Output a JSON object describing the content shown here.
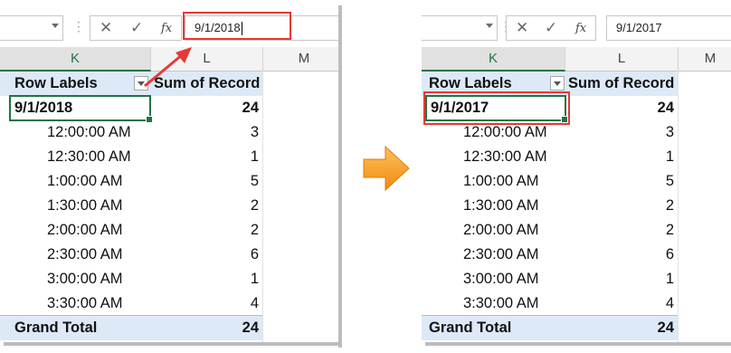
{
  "left": {
    "formula": {
      "value": "9/1/2018",
      "fx_label": "fx"
    },
    "columns": [
      "K",
      "L",
      "M"
    ],
    "header": {
      "row_labels": "Row Labels",
      "sum_label": "Sum of Record"
    },
    "date_row": {
      "label": "9/1/2018",
      "value": "24"
    },
    "rows": [
      {
        "label": "12:00:00 AM",
        "value": "3"
      },
      {
        "label": "12:30:00 AM",
        "value": "1"
      },
      {
        "label": "1:00:00 AM",
        "value": "5"
      },
      {
        "label": "1:30:00 AM",
        "value": "2"
      },
      {
        "label": "2:00:00 AM",
        "value": "2"
      },
      {
        "label": "2:30:00 AM",
        "value": "6"
      },
      {
        "label": "3:00:00 AM",
        "value": "1"
      },
      {
        "label": "3:30:00 AM",
        "value": "4"
      }
    ],
    "grand_total": {
      "label": "Grand Total",
      "value": "24"
    }
  },
  "right": {
    "formula": {
      "value": "9/1/2017",
      "fx_label": "fx"
    },
    "columns": [
      "K",
      "L",
      "M"
    ],
    "header": {
      "row_labels": "Row Labels",
      "sum_label": "Sum of Record"
    },
    "date_row": {
      "label": "9/1/2017",
      "value": "24"
    },
    "rows": [
      {
        "label": "12:00:00 AM",
        "value": "3"
      },
      {
        "label": "12:30:00 AM",
        "value": "1"
      },
      {
        "label": "1:00:00 AM",
        "value": "5"
      },
      {
        "label": "1:30:00 AM",
        "value": "2"
      },
      {
        "label": "2:00:00 AM",
        "value": "2"
      },
      {
        "label": "2:30:00 AM",
        "value": "6"
      },
      {
        "label": "3:00:00 AM",
        "value": "1"
      },
      {
        "label": "3:30:00 AM",
        "value": "4"
      }
    ],
    "grand_total": {
      "label": "Grand Total",
      "value": "24"
    }
  },
  "colors": {
    "accent_green": "#217346",
    "highlight_red": "#e53935",
    "arrow_orange": "#f7931e",
    "pivot_header_blue": "#dde9f6"
  },
  "icons": {
    "cancel": "close-icon",
    "enter": "check-icon",
    "function": "fx-icon",
    "transition": "right-arrow-icon"
  }
}
